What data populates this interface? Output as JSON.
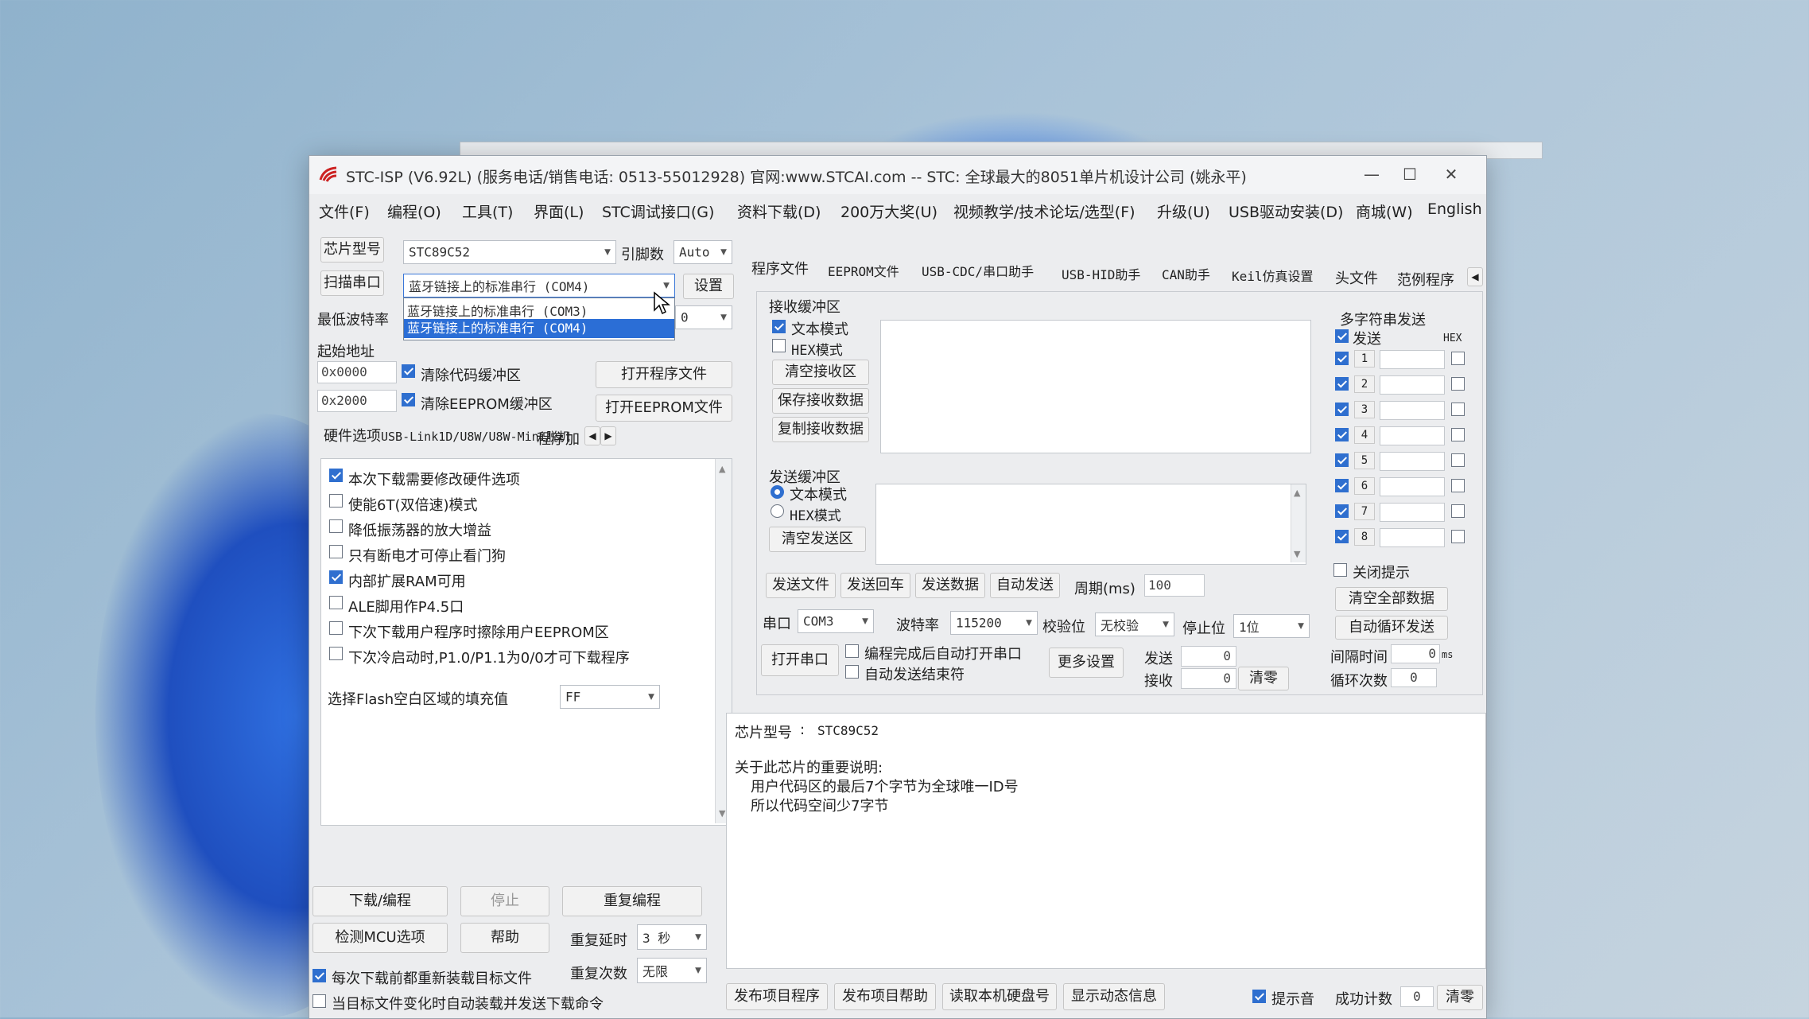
{
  "window": {
    "title": "STC-ISP (V6.92L) (服务电话/销售电话: 0513-55012928) 官网:www.STCAI.com  -- STC: 全球最大的8051单片机设计公司 (姚永平)",
    "minimize": "—",
    "maximize": "☐",
    "close": "✕"
  },
  "menu": [
    "文件(F)",
    "编程(O)",
    "工具(T)",
    "界面(L)",
    "STC调试接口(G)",
    "资料下载(D)",
    "200万大奖(U)",
    "视频教学/技术论坛/选型(F)",
    "升级(U)",
    "USB驱动安装(D)",
    "商城(W)",
    "English"
  ],
  "left": {
    "chip_label": "芯片型号",
    "chip_value": "STC89C52",
    "pin_label": "引脚数",
    "pin_value": "Auto",
    "scan_button": "扫描串口",
    "port_value": "蓝牙链接上的标准串行 (COM4)",
    "port_options": [
      "蓝牙链接上的标准串行 (COM3)",
      "蓝牙链接上的标准串行 (COM4)"
    ],
    "settings_button": "设置",
    "baud_label": "最低波特率",
    "baud_value": "0",
    "start_addr_label": "起始地址",
    "addr1": "0x0000",
    "clear_code": "清除代码缓冲区",
    "open_program": "打开程序文件",
    "addr2": "0x2000",
    "clear_eeprom": "清除EEPROM缓冲区",
    "open_eeprom": "打开EEPROM文件",
    "subtabs": [
      "硬件选项",
      "USB-Link1D/U8W/U8W-Mini脱机",
      "程序加"
    ],
    "hw_options": [
      {
        "label": "本次下载需要修改硬件选项",
        "checked": true
      },
      {
        "label": "使能6T(双倍速)模式",
        "checked": false
      },
      {
        "label": "降低振荡器的放大增益",
        "checked": false
      },
      {
        "label": "只有断电才可停止看门狗",
        "checked": false
      },
      {
        "label": "内部扩展RAM可用",
        "checked": true
      },
      {
        "label": "ALE脚用作P4.5口",
        "checked": false
      },
      {
        "label": "下次下载用户程序时擦除用户EEPROM区",
        "checked": false
      },
      {
        "label": "下次冷启动时,P1.0/P1.1为0/0才可下载程序",
        "checked": false
      }
    ],
    "fill_label": "选择Flash空白区域的填充值",
    "fill_value": "FF",
    "download_button": "下载/编程",
    "stop_button": "停止",
    "reprogram_button": "重复编程",
    "detect_button": "检测MCU选项",
    "help_button": "帮助",
    "delay_label": "重复延时",
    "delay_value": "3 秒",
    "count_label": "重复次数",
    "count_value": "无限",
    "reload_label": "每次下载前都重新装载目标文件",
    "autosend_label": "当目标文件变化时自动装载并发送下载命令"
  },
  "right": {
    "tabs": [
      "程序文件",
      "EEPROM文件",
      "USB-CDC/串口助手",
      "USB-HID助手",
      "CAN助手",
      "Keil仿真设置",
      "头文件",
      "范例程序"
    ],
    "recv_title": "接收缓冲区",
    "recv_text_mode": "文本模式",
    "recv_hex_mode": "HEX模式",
    "clear_recv": "清空接收区",
    "save_recv": "保存接收数据",
    "copy_recv": "复制接收数据",
    "send_title": "发送缓冲区",
    "send_text_mode": "文本模式",
    "send_hex_mode": "HEX模式",
    "clear_send": "清空发送区",
    "send_file": "发送文件",
    "send_enter": "发送回车",
    "send_data": "发送数据",
    "auto_send": "自动发送",
    "period_label": "周期(ms)",
    "period_value": "100",
    "port_label": "串口",
    "port_value": "COM3",
    "baud_label": "波特率",
    "baud_value": "115200",
    "parity_label": "校验位",
    "parity_value": "无校验",
    "stop_label": "停止位",
    "stop_value": "1位",
    "open_port": "打开串口",
    "opt_autoopen": "编程完成后自动打开串口",
    "opt_autosend_end": "自动发送结束符",
    "more_settings": "更多设置",
    "sent_label": "发送",
    "sent_value": "0",
    "recv_label": "接收",
    "recv_value": "0",
    "clear_counts": "清零",
    "multi_title": "多字符串发送",
    "multi_send_label": "发送",
    "multi_hex_label": "HEX",
    "multi_rows": [
      "1",
      "2",
      "3",
      "4",
      "5",
      "6",
      "7",
      "8"
    ],
    "close_tip": "关闭提示",
    "clear_all": "清空全部数据",
    "auto_cycle": "自动循环发送",
    "interval_label": "间隔时间",
    "interval_value": "0",
    "interval_unit": "ms",
    "cycle_label": "循环次数",
    "cycle_value": "0"
  },
  "info": {
    "chip_line_label": "芯片型号",
    "chip_line_sep": ":",
    "chip_line_value": "STC89C52",
    "note_title": "关于此芯片的重要说明:",
    "note_line1": "用户代码区的最后7个字节为全球唯一ID号",
    "note_line2": "所以代码空间少7字节"
  },
  "bottom": {
    "publish_program": "发布项目程序",
    "publish_help": "发布项目帮助",
    "read_disk": "读取本机硬盘号",
    "show_dynamic": "显示动态信息",
    "tip_label": "提示音",
    "success_label": "成功计数",
    "success_value": "0",
    "clear": "清零"
  }
}
